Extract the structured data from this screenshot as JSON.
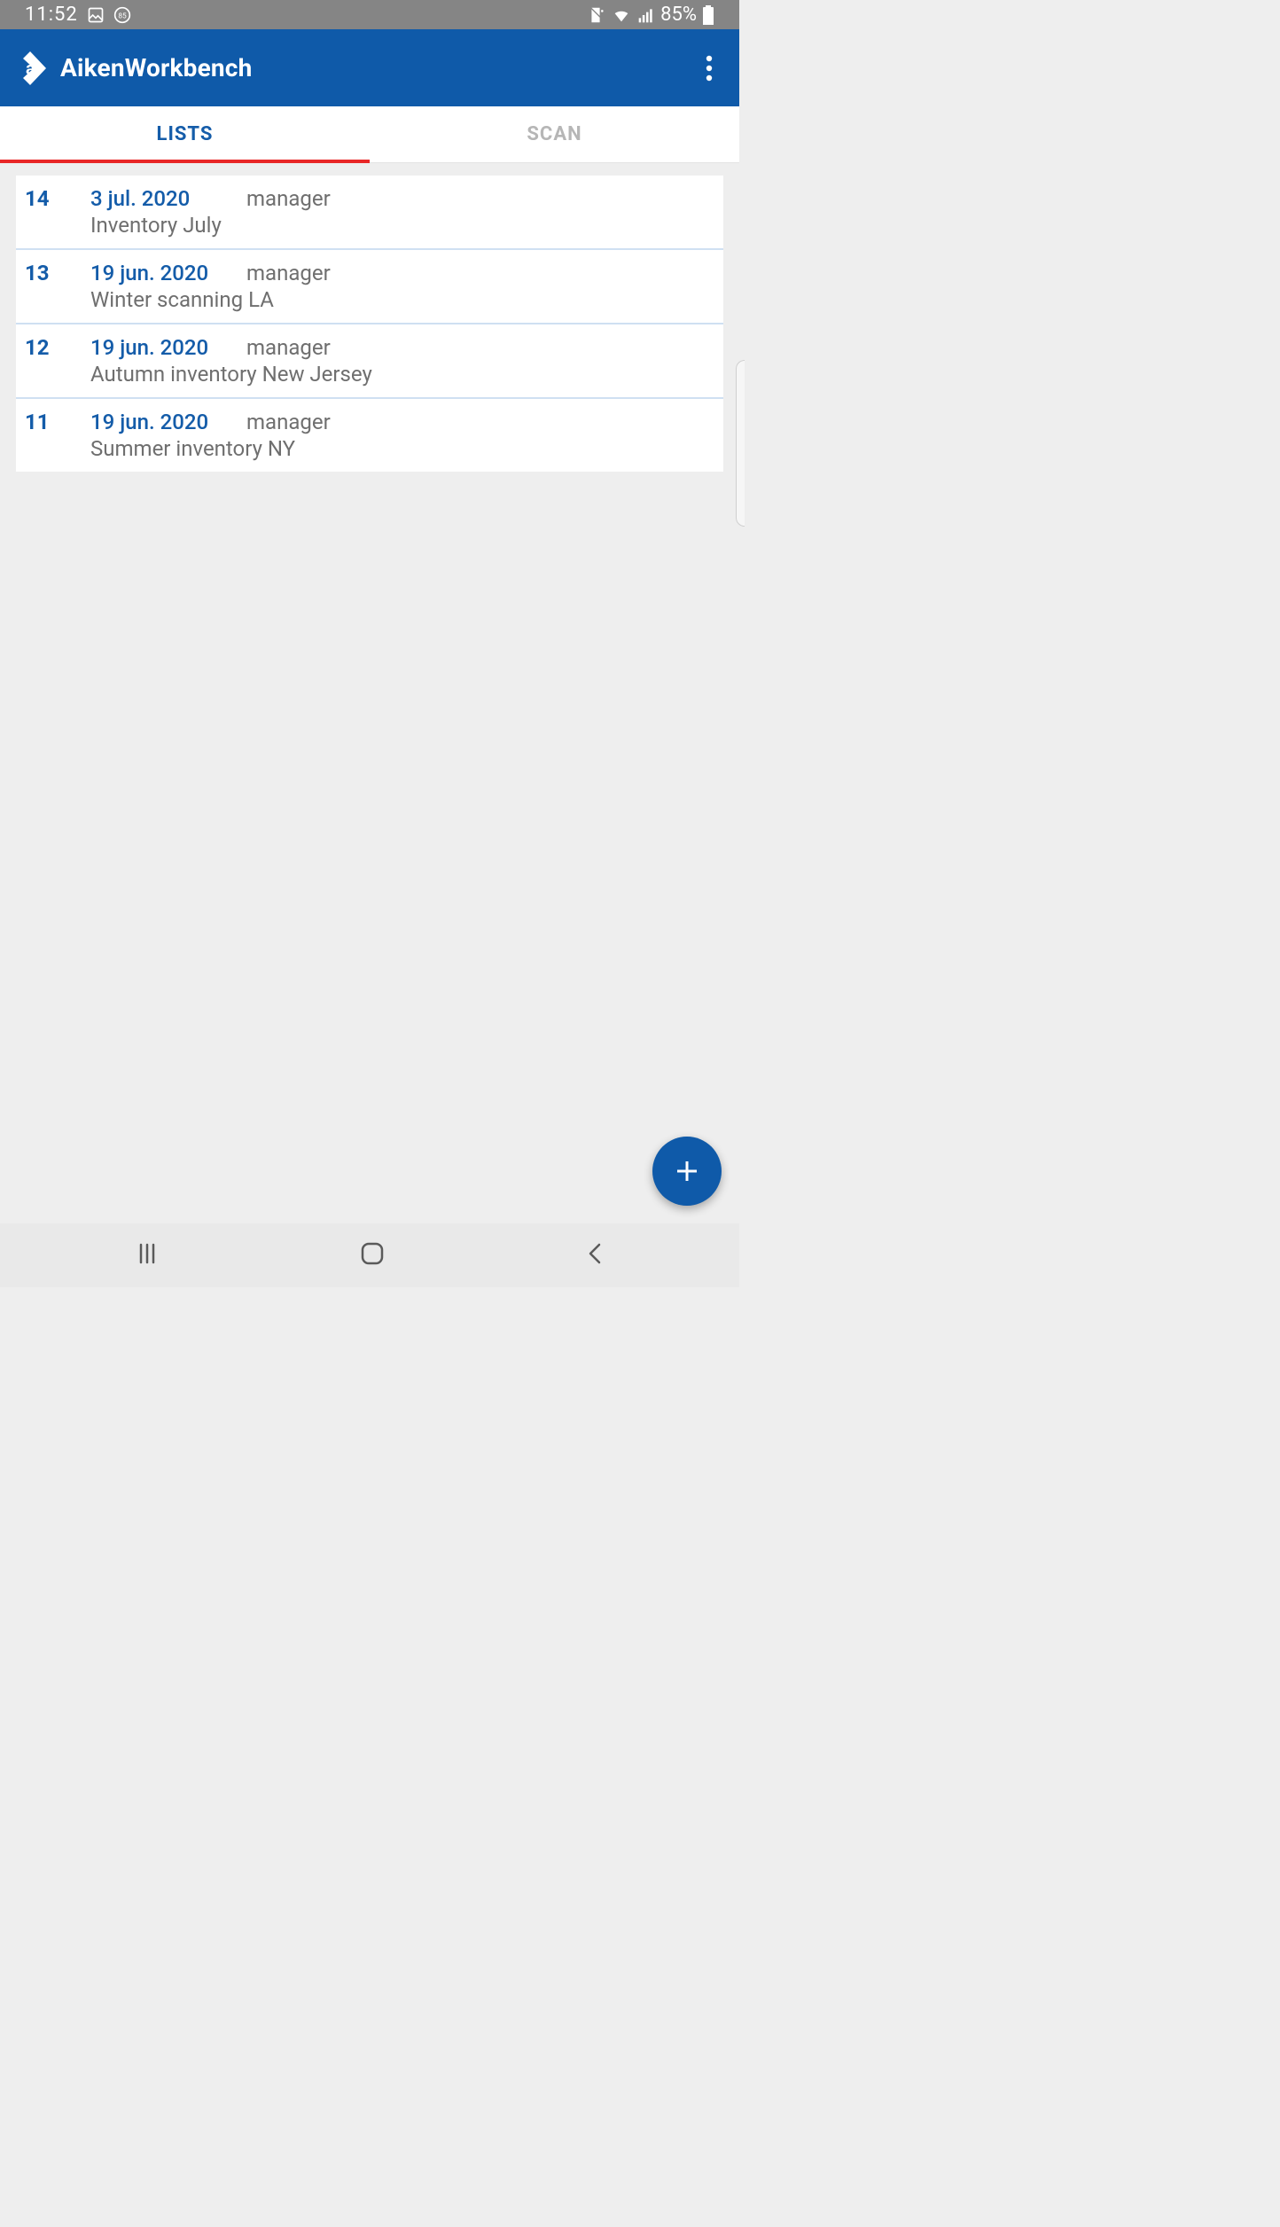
{
  "status": {
    "time": "11:52",
    "battery": "85%",
    "badge_number": "85",
    "icons": {
      "image": "image-icon",
      "badge": "quota-badge",
      "mute": "vibrate-mute-icon",
      "wifi": "wifi-icon",
      "signal": "signal-icon",
      "battery": "battery-icon"
    }
  },
  "header": {
    "app_name": "AikenWorkbench",
    "logo_letter": "a"
  },
  "tabs": {
    "lists": "LISTS",
    "scan": "SCAN",
    "active": "lists"
  },
  "lists": {
    "items": [
      {
        "id": "14",
        "date": "3 jul. 2020",
        "owner": "manager",
        "description": "Inventory July"
      },
      {
        "id": "13",
        "date": "19 jun. 2020",
        "owner": "manager",
        "description": "Winter scanning LA"
      },
      {
        "id": "12",
        "date": "19 jun. 2020",
        "owner": "manager",
        "description": "Autumn inventory New Jersey"
      },
      {
        "id": "11",
        "date": "19 jun. 2020",
        "owner": "manager",
        "description": "Summer inventory NY"
      }
    ]
  },
  "fab": {
    "label": "+"
  },
  "nav": {
    "recent": "recent-apps",
    "home": "home",
    "back": "back"
  },
  "colors": {
    "brand": "#0f5aa9",
    "accent": "#e82626",
    "muted_text": "#6f6f6f"
  }
}
